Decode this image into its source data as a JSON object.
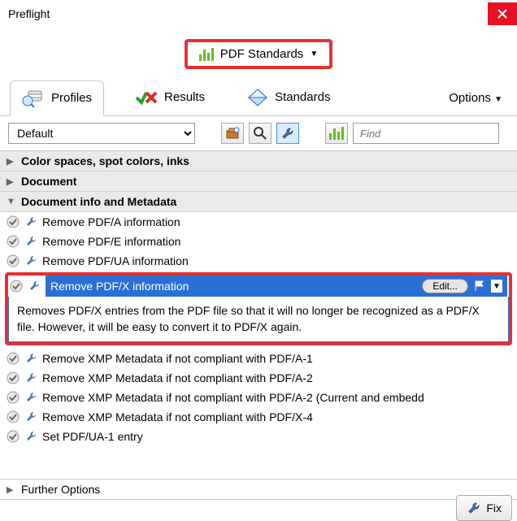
{
  "window": {
    "title": "Preflight"
  },
  "dropdown": {
    "label": "PDF Standards"
  },
  "tabs": {
    "profiles": "Profiles",
    "results": "Results",
    "standards": "Standards",
    "options": "Options"
  },
  "toolbar": {
    "preset": "Default",
    "find_placeholder": "Find"
  },
  "categories": {
    "c0": "Color spaces, spot colors, inks",
    "c1": "Document",
    "c2": "Document info and Metadata"
  },
  "items": {
    "i0": "Remove PDF/A information",
    "i1": "Remove PDF/E information",
    "i2": "Remove PDF/UA information",
    "i3": "Remove PDF/X information",
    "i4": "Remove XMP Metadata if not compliant with PDF/A-1",
    "i5": "Remove XMP Metadata if not compliant with PDF/A-2",
    "i6": "Remove XMP Metadata if not compliant with PDF/A-2 (Current and embedd",
    "i7": "Remove XMP Metadata if not compliant with PDF/X-4",
    "i8": "Set PDF/UA-1 entry"
  },
  "selected": {
    "edit": "Edit...",
    "description": "Removes PDF/X entries from the PDF file so that it will no longer be recognized as a PDF/X file. However, it will be easy to convert it to PDF/X again."
  },
  "footer": {
    "further": "Further Options",
    "fix": "Fix"
  }
}
